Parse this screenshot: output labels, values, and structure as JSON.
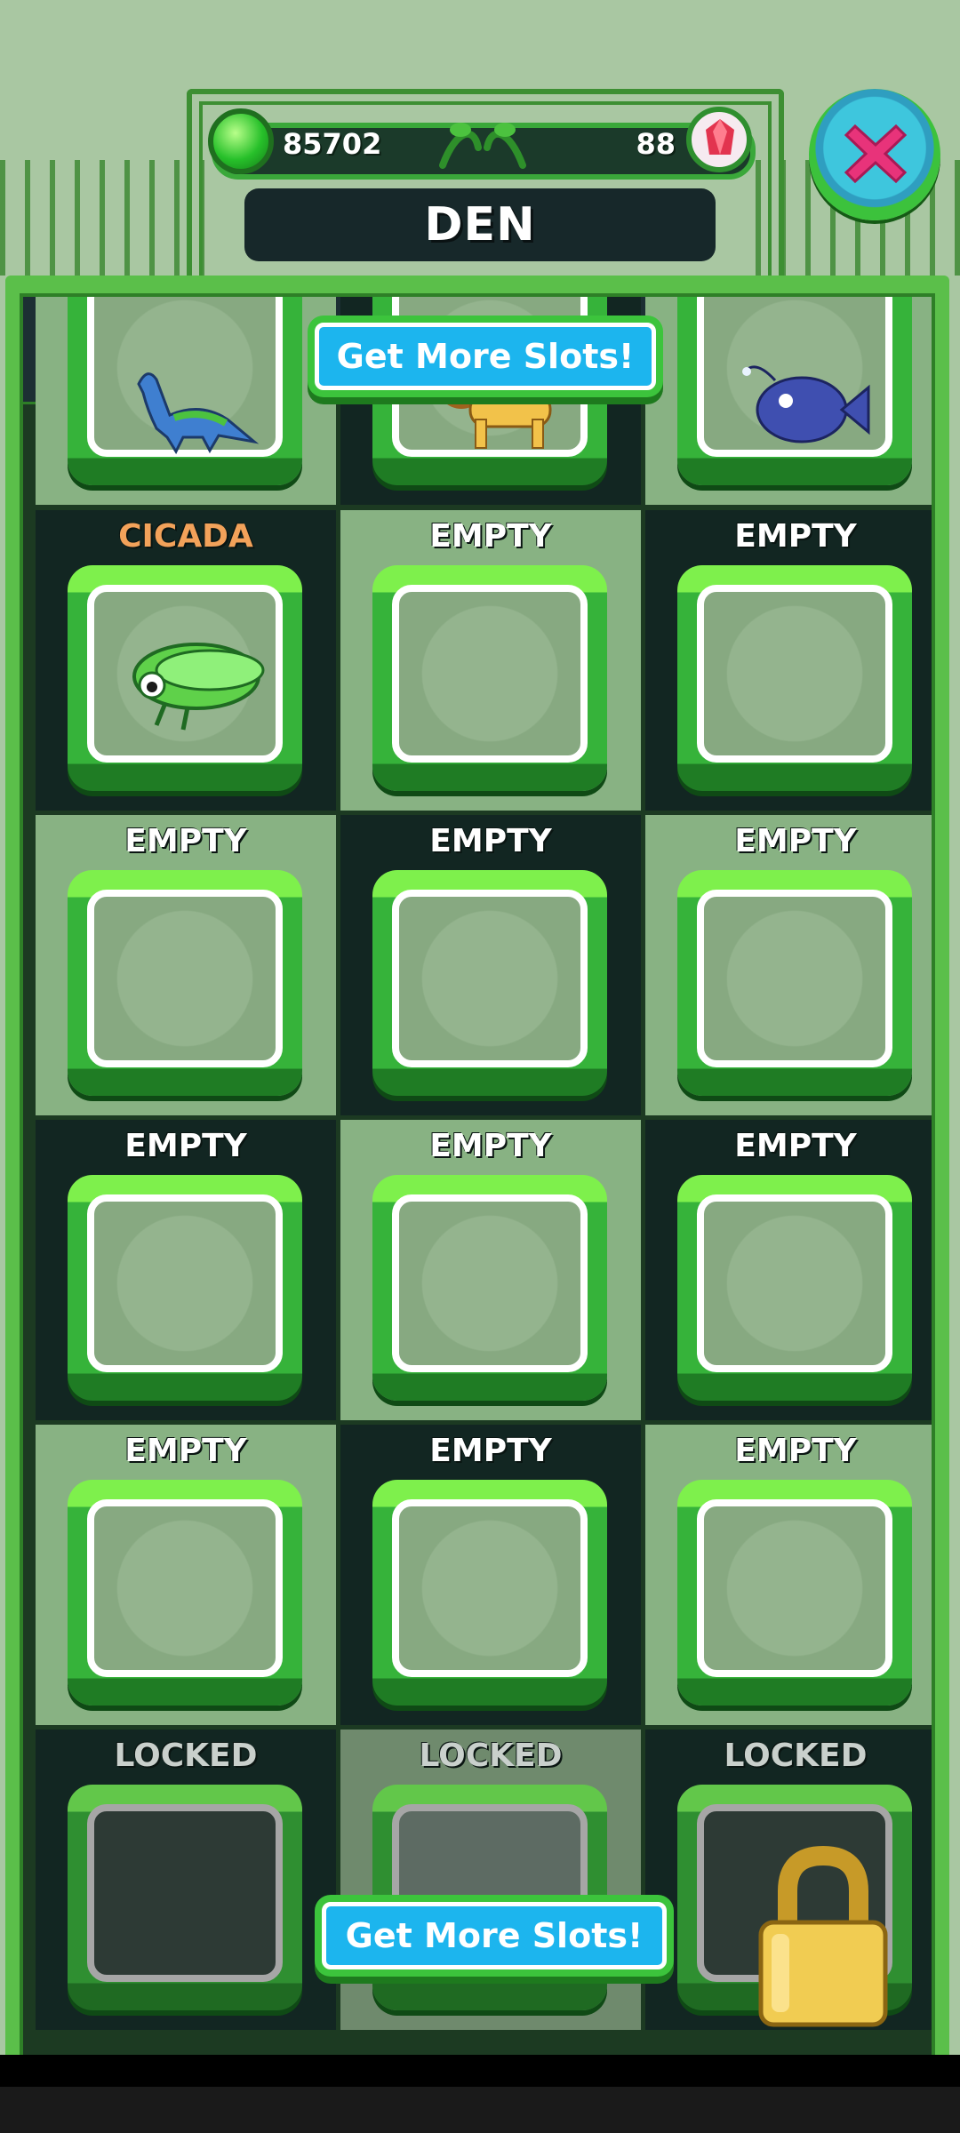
{
  "header": {
    "title": "DEN",
    "gel_count": "85702",
    "gem_count": "88"
  },
  "buttons": {
    "get_more_slots_top": "Get More Slots!",
    "get_more_slots_bottom": "Get More Slots!"
  },
  "slots": {
    "row0": [
      {
        "label": "",
        "pet": "dinosaur"
      },
      {
        "label": "",
        "pet": "lion"
      },
      {
        "label": "",
        "pet": "anglerfish"
      }
    ],
    "row1": [
      {
        "label": "CICADA",
        "pet": "cicada"
      },
      {
        "label": "EMPTY",
        "pet": ""
      },
      {
        "label": "EMPTY",
        "pet": ""
      }
    ],
    "row2": [
      {
        "label": "EMPTY",
        "pet": ""
      },
      {
        "label": "EMPTY",
        "pet": ""
      },
      {
        "label": "EMPTY",
        "pet": ""
      }
    ],
    "row3": [
      {
        "label": "EMPTY",
        "pet": ""
      },
      {
        "label": "EMPTY",
        "pet": ""
      },
      {
        "label": "EMPTY",
        "pet": ""
      }
    ],
    "row4": [
      {
        "label": "EMPTY",
        "pet": ""
      },
      {
        "label": "EMPTY",
        "pet": ""
      },
      {
        "label": "EMPTY",
        "pet": ""
      }
    ],
    "row5": [
      {
        "label": "LOCKED",
        "pet": ""
      },
      {
        "label": "LOCKED",
        "pet": ""
      },
      {
        "label": "LOCKED",
        "pet": ""
      }
    ]
  },
  "icons": {
    "gel": "green-gel-icon",
    "gem": "red-gem-icon",
    "close": "close-x-icon",
    "lock": "padlock-icon"
  },
  "colors": {
    "accent_green": "#3cc43c",
    "button_blue": "#1cb5ee",
    "label_orange": "#f2a25a"
  }
}
